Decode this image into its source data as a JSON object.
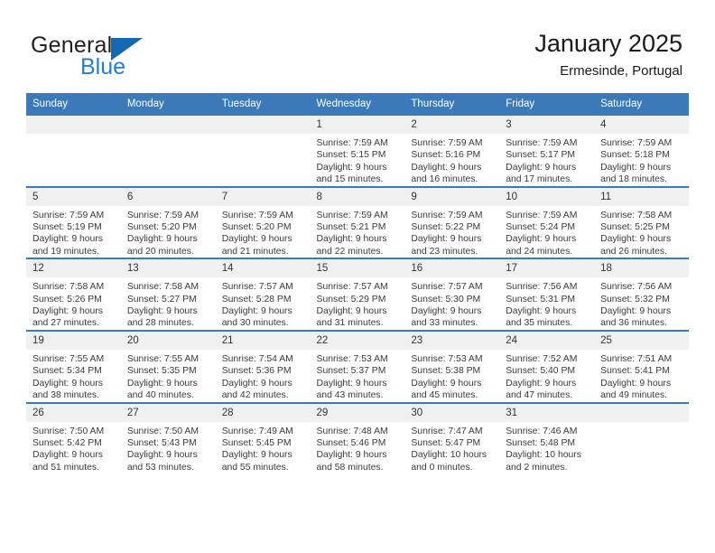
{
  "brand": {
    "name_top": "General",
    "name_bottom": "Blue",
    "accent_color": "#1668b3"
  },
  "header": {
    "title": "January 2025",
    "subtitle": "Ermesinde, Portugal"
  },
  "theme": {
    "header_blue": "#3b79b8",
    "daynum_band": "#f0f0f0"
  },
  "weekday_headers": [
    "Sunday",
    "Monday",
    "Tuesday",
    "Wednesday",
    "Thursday",
    "Friday",
    "Saturday"
  ],
  "weeks": [
    [
      {
        "day": "",
        "sunrise": "",
        "sunset": "",
        "daylight": ""
      },
      {
        "day": "",
        "sunrise": "",
        "sunset": "",
        "daylight": ""
      },
      {
        "day": "",
        "sunrise": "",
        "sunset": "",
        "daylight": ""
      },
      {
        "day": "1",
        "sunrise": "Sunrise: 7:59 AM",
        "sunset": "Sunset: 5:15 PM",
        "daylight": "Daylight: 9 hours and 15 minutes."
      },
      {
        "day": "2",
        "sunrise": "Sunrise: 7:59 AM",
        "sunset": "Sunset: 5:16 PM",
        "daylight": "Daylight: 9 hours and 16 minutes."
      },
      {
        "day": "3",
        "sunrise": "Sunrise: 7:59 AM",
        "sunset": "Sunset: 5:17 PM",
        "daylight": "Daylight: 9 hours and 17 minutes."
      },
      {
        "day": "4",
        "sunrise": "Sunrise: 7:59 AM",
        "sunset": "Sunset: 5:18 PM",
        "daylight": "Daylight: 9 hours and 18 minutes."
      }
    ],
    [
      {
        "day": "5",
        "sunrise": "Sunrise: 7:59 AM",
        "sunset": "Sunset: 5:19 PM",
        "daylight": "Daylight: 9 hours and 19 minutes."
      },
      {
        "day": "6",
        "sunrise": "Sunrise: 7:59 AM",
        "sunset": "Sunset: 5:20 PM",
        "daylight": "Daylight: 9 hours and 20 minutes."
      },
      {
        "day": "7",
        "sunrise": "Sunrise: 7:59 AM",
        "sunset": "Sunset: 5:20 PM",
        "daylight": "Daylight: 9 hours and 21 minutes."
      },
      {
        "day": "8",
        "sunrise": "Sunrise: 7:59 AM",
        "sunset": "Sunset: 5:21 PM",
        "daylight": "Daylight: 9 hours and 22 minutes."
      },
      {
        "day": "9",
        "sunrise": "Sunrise: 7:59 AM",
        "sunset": "Sunset: 5:22 PM",
        "daylight": "Daylight: 9 hours and 23 minutes."
      },
      {
        "day": "10",
        "sunrise": "Sunrise: 7:59 AM",
        "sunset": "Sunset: 5:24 PM",
        "daylight": "Daylight: 9 hours and 24 minutes."
      },
      {
        "day": "11",
        "sunrise": "Sunrise: 7:58 AM",
        "sunset": "Sunset: 5:25 PM",
        "daylight": "Daylight: 9 hours and 26 minutes."
      }
    ],
    [
      {
        "day": "12",
        "sunrise": "Sunrise: 7:58 AM",
        "sunset": "Sunset: 5:26 PM",
        "daylight": "Daylight: 9 hours and 27 minutes."
      },
      {
        "day": "13",
        "sunrise": "Sunrise: 7:58 AM",
        "sunset": "Sunset: 5:27 PM",
        "daylight": "Daylight: 9 hours and 28 minutes."
      },
      {
        "day": "14",
        "sunrise": "Sunrise: 7:57 AM",
        "sunset": "Sunset: 5:28 PM",
        "daylight": "Daylight: 9 hours and 30 minutes."
      },
      {
        "day": "15",
        "sunrise": "Sunrise: 7:57 AM",
        "sunset": "Sunset: 5:29 PM",
        "daylight": "Daylight: 9 hours and 31 minutes."
      },
      {
        "day": "16",
        "sunrise": "Sunrise: 7:57 AM",
        "sunset": "Sunset: 5:30 PM",
        "daylight": "Daylight: 9 hours and 33 minutes."
      },
      {
        "day": "17",
        "sunrise": "Sunrise: 7:56 AM",
        "sunset": "Sunset: 5:31 PM",
        "daylight": "Daylight: 9 hours and 35 minutes."
      },
      {
        "day": "18",
        "sunrise": "Sunrise: 7:56 AM",
        "sunset": "Sunset: 5:32 PM",
        "daylight": "Daylight: 9 hours and 36 minutes."
      }
    ],
    [
      {
        "day": "19",
        "sunrise": "Sunrise: 7:55 AM",
        "sunset": "Sunset: 5:34 PM",
        "daylight": "Daylight: 9 hours and 38 minutes."
      },
      {
        "day": "20",
        "sunrise": "Sunrise: 7:55 AM",
        "sunset": "Sunset: 5:35 PM",
        "daylight": "Daylight: 9 hours and 40 minutes."
      },
      {
        "day": "21",
        "sunrise": "Sunrise: 7:54 AM",
        "sunset": "Sunset: 5:36 PM",
        "daylight": "Daylight: 9 hours and 42 minutes."
      },
      {
        "day": "22",
        "sunrise": "Sunrise: 7:53 AM",
        "sunset": "Sunset: 5:37 PM",
        "daylight": "Daylight: 9 hours and 43 minutes."
      },
      {
        "day": "23",
        "sunrise": "Sunrise: 7:53 AM",
        "sunset": "Sunset: 5:38 PM",
        "daylight": "Daylight: 9 hours and 45 minutes."
      },
      {
        "day": "24",
        "sunrise": "Sunrise: 7:52 AM",
        "sunset": "Sunset: 5:40 PM",
        "daylight": "Daylight: 9 hours and 47 minutes."
      },
      {
        "day": "25",
        "sunrise": "Sunrise: 7:51 AM",
        "sunset": "Sunset: 5:41 PM",
        "daylight": "Daylight: 9 hours and 49 minutes."
      }
    ],
    [
      {
        "day": "26",
        "sunrise": "Sunrise: 7:50 AM",
        "sunset": "Sunset: 5:42 PM",
        "daylight": "Daylight: 9 hours and 51 minutes."
      },
      {
        "day": "27",
        "sunrise": "Sunrise: 7:50 AM",
        "sunset": "Sunset: 5:43 PM",
        "daylight": "Daylight: 9 hours and 53 minutes."
      },
      {
        "day": "28",
        "sunrise": "Sunrise: 7:49 AM",
        "sunset": "Sunset: 5:45 PM",
        "daylight": "Daylight: 9 hours and 55 minutes."
      },
      {
        "day": "29",
        "sunrise": "Sunrise: 7:48 AM",
        "sunset": "Sunset: 5:46 PM",
        "daylight": "Daylight: 9 hours and 58 minutes."
      },
      {
        "day": "30",
        "sunrise": "Sunrise: 7:47 AM",
        "sunset": "Sunset: 5:47 PM",
        "daylight": "Daylight: 10 hours and 0 minutes."
      },
      {
        "day": "31",
        "sunrise": "Sunrise: 7:46 AM",
        "sunset": "Sunset: 5:48 PM",
        "daylight": "Daylight: 10 hours and 2 minutes."
      },
      {
        "day": "",
        "sunrise": "",
        "sunset": "",
        "daylight": ""
      }
    ]
  ]
}
